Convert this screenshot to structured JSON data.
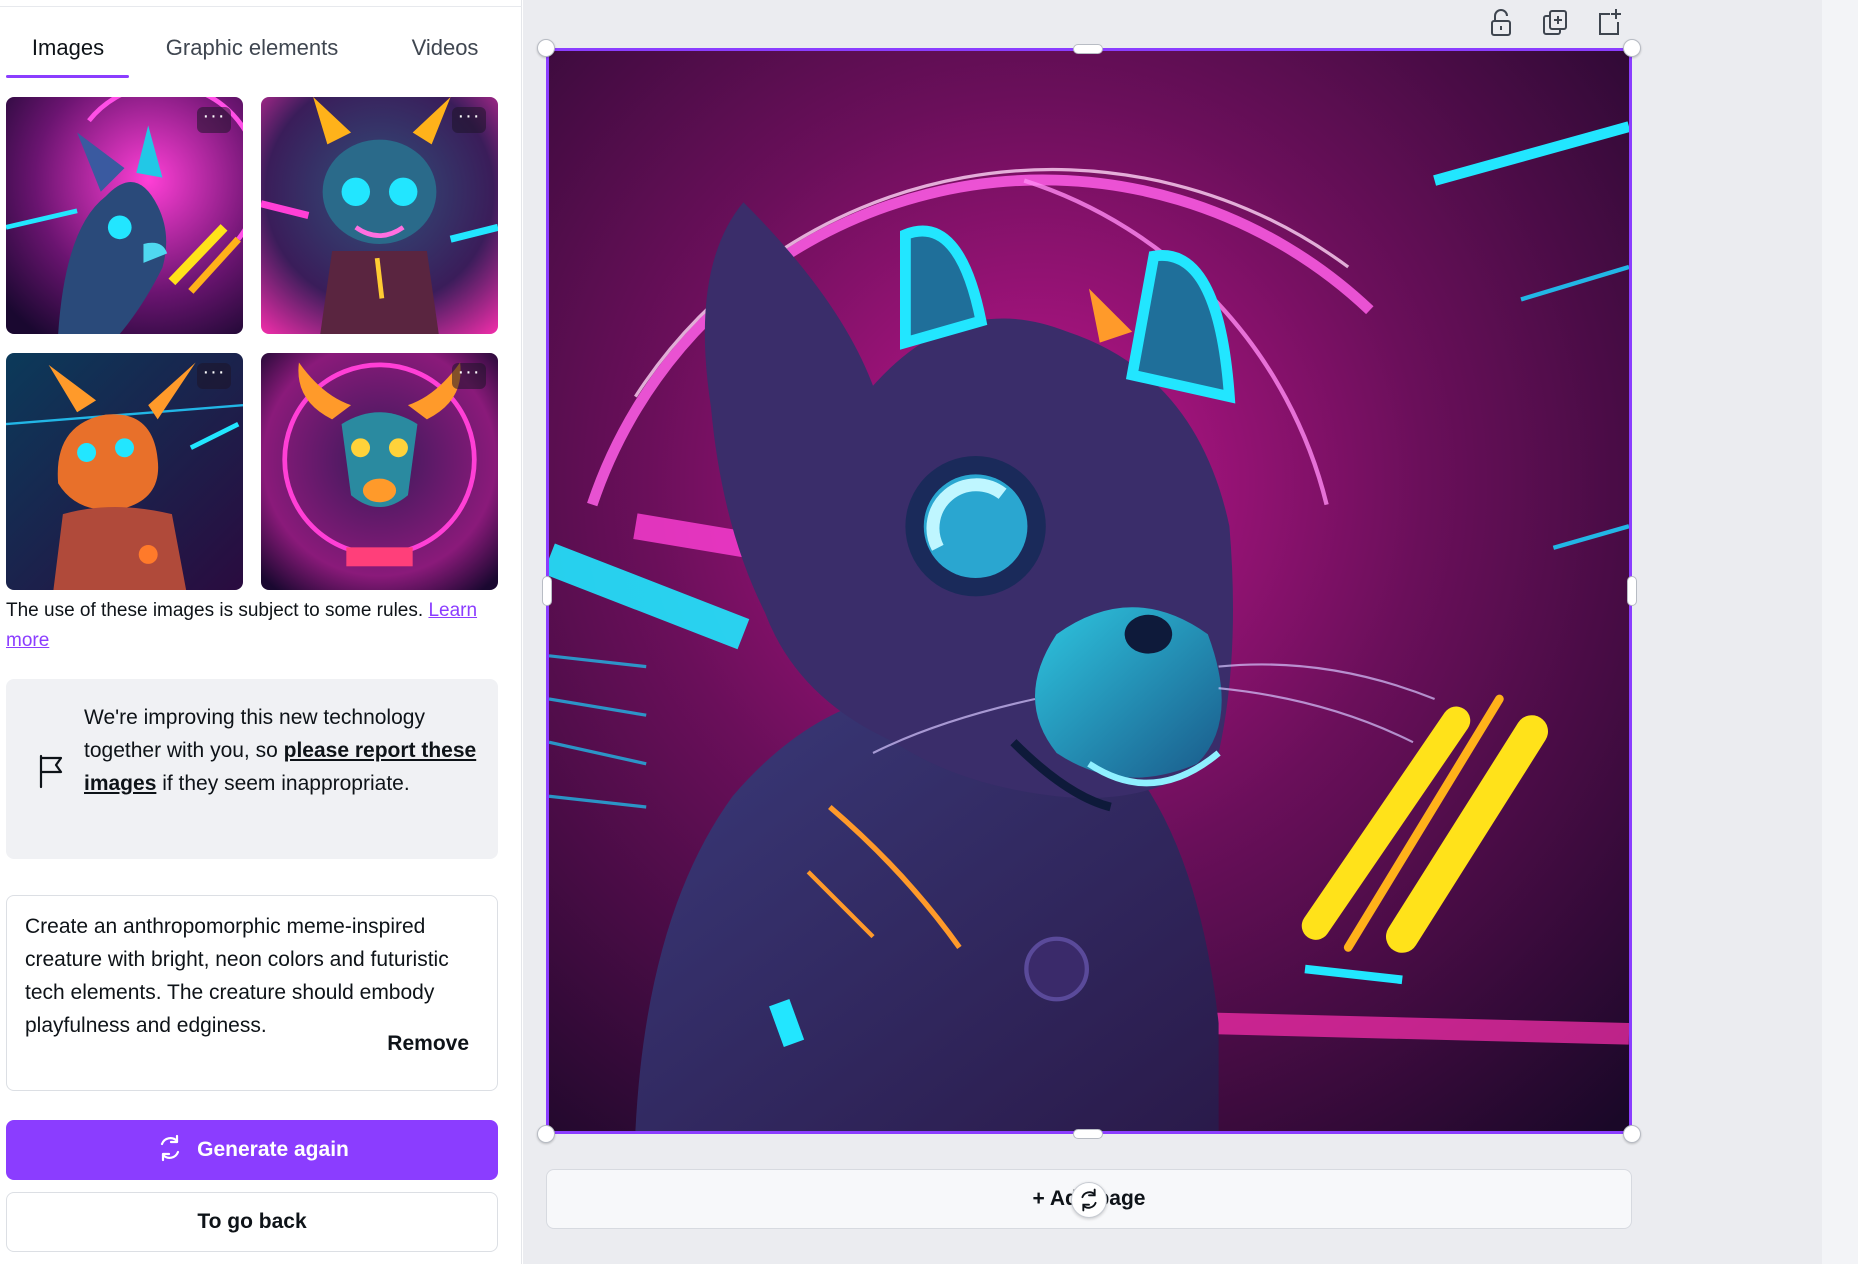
{
  "tabs": [
    {
      "label": "Images"
    },
    {
      "label": "Graphic elements"
    },
    {
      "label": "Videos"
    }
  ],
  "thumbnails": {
    "more_label": "···",
    "items": [
      {
        "name": "thumbnail-cyber-cat"
      },
      {
        "name": "thumbnail-cyber-creature"
      },
      {
        "name": "thumbnail-orange-dragon"
      },
      {
        "name": "thumbnail-horned-creature"
      }
    ]
  },
  "rules": {
    "text": "The use of these images is subject to some rules.",
    "link": "Learn more"
  },
  "notice": {
    "text_before": "We're improving this new technology together with you, so ",
    "link": "please report these images",
    "text_after": " if they seem inappropriate.",
    "icon": "flag-icon"
  },
  "prompt": {
    "text": "Create an anthropomorphic meme-inspired creature with bright, neon colors and futuristic tech elements. The creature should embody playfulness and edginess.",
    "remove_label": "Remove"
  },
  "buttons": {
    "generate_again": "Generate again",
    "go_back": "To go back"
  },
  "canvas": {
    "add_page": "+ Add page",
    "toolbar_icons": [
      "lock-icon",
      "duplicate-page-icon",
      "add-page-icon"
    ]
  },
  "colors": {
    "accent": "#8b3dff",
    "neon_pink": "#ff2fd0",
    "neon_cyan": "#22e6ff",
    "neon_yellow": "#ffe21a"
  }
}
